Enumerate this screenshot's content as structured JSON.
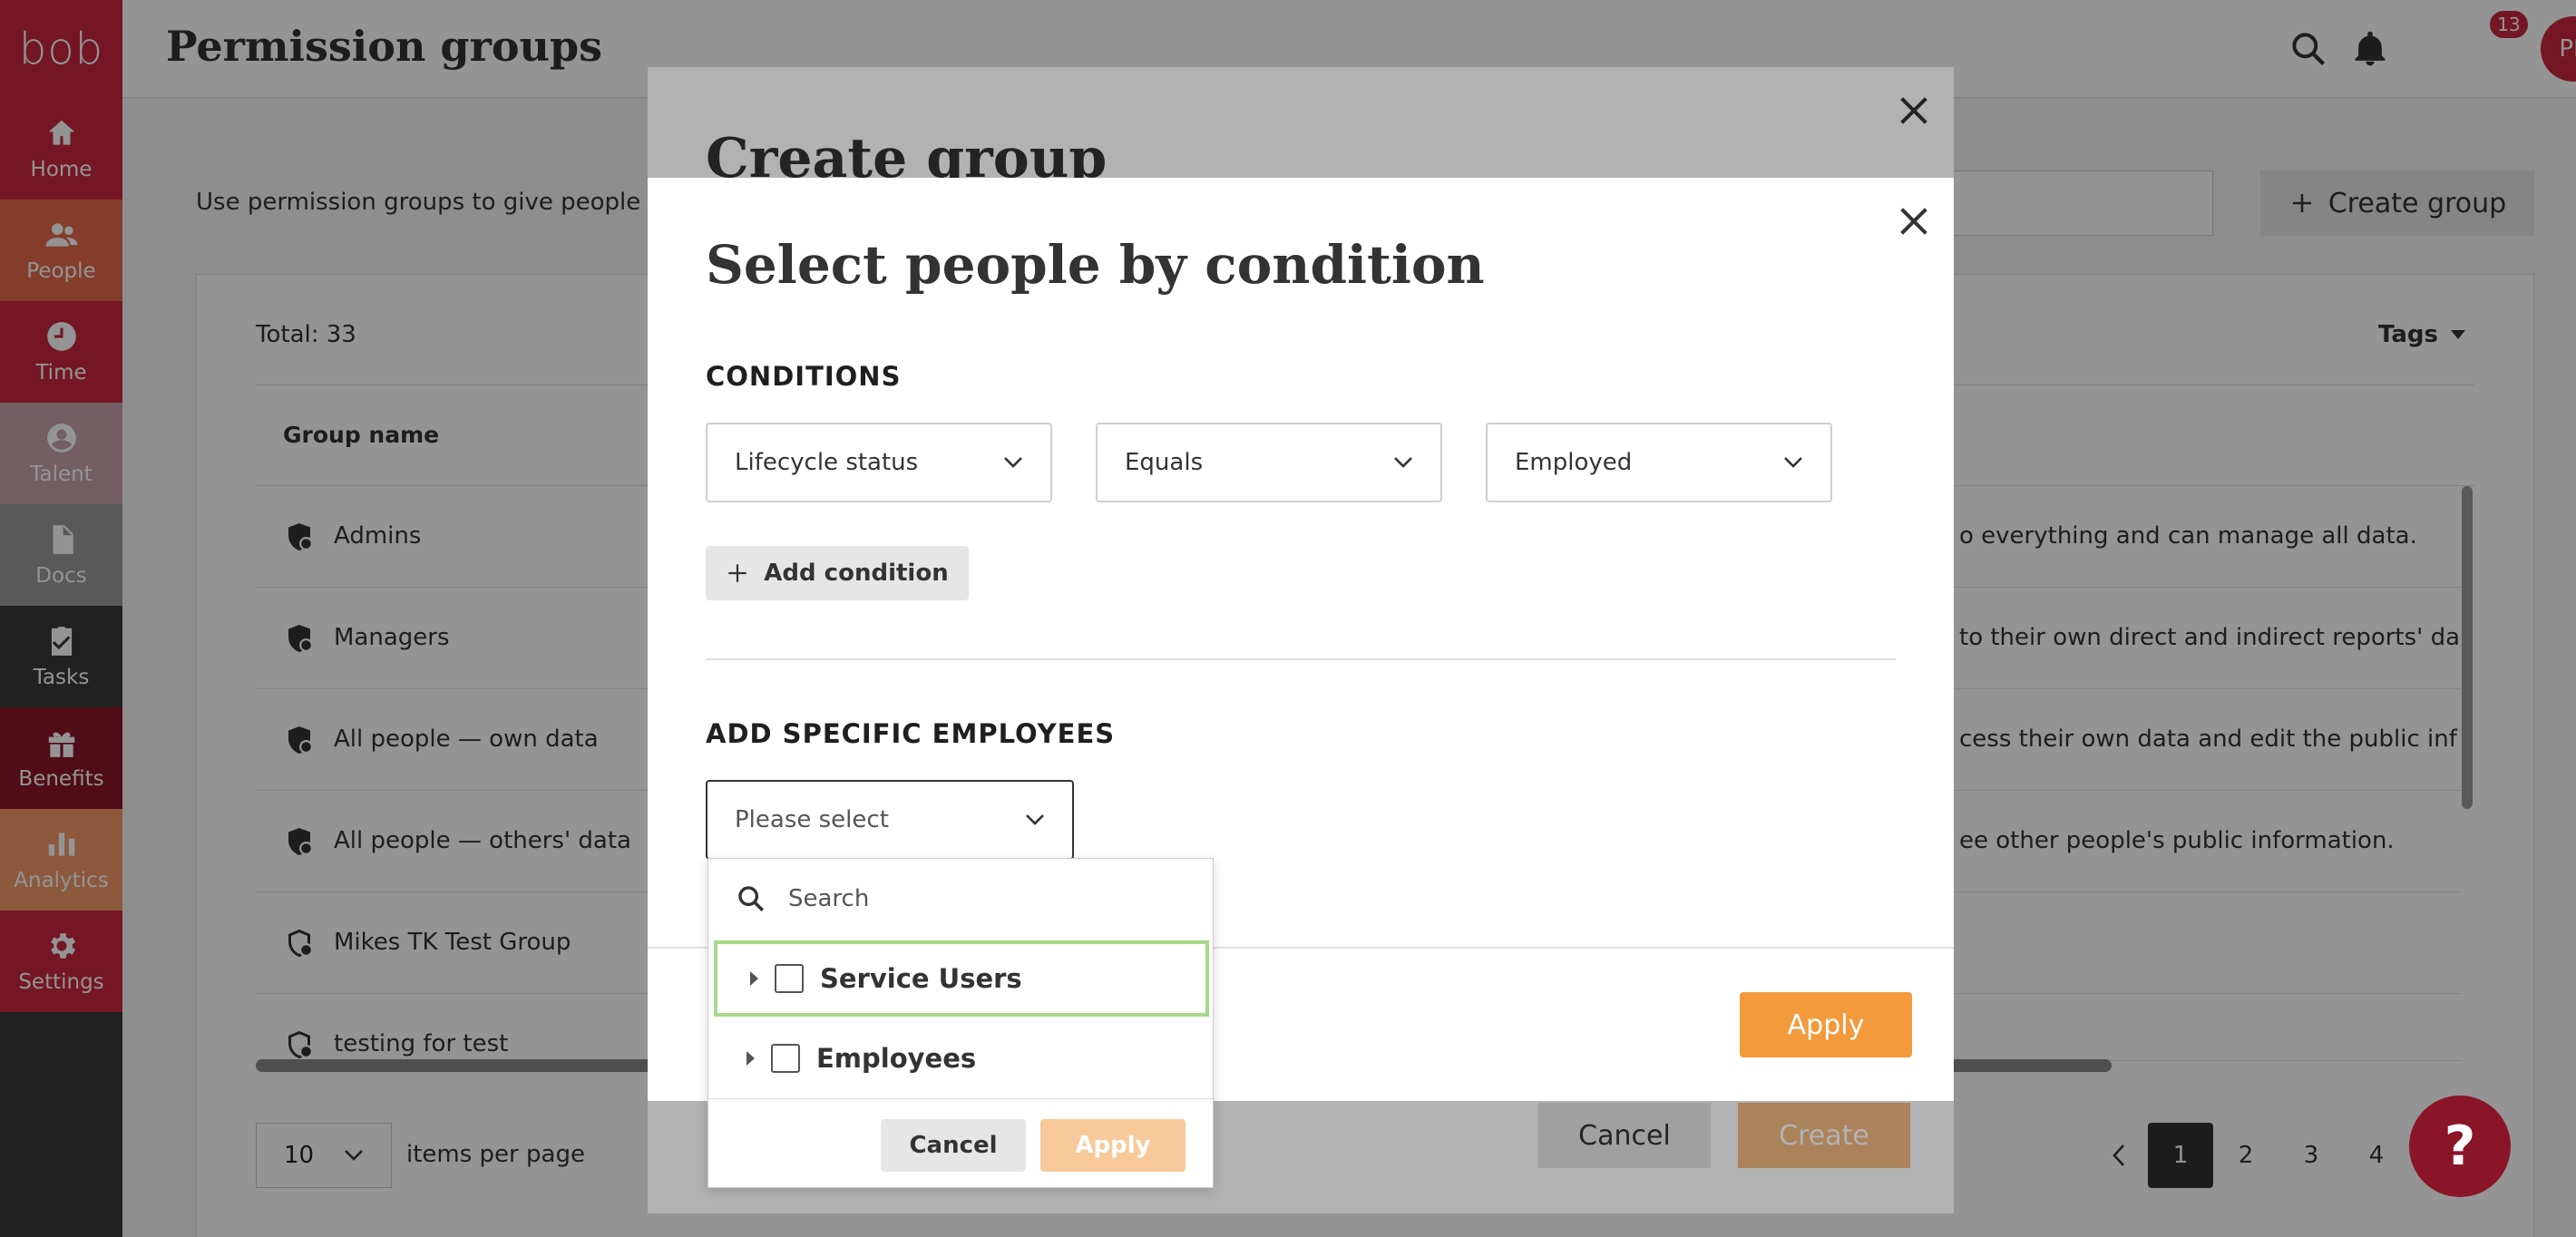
{
  "app": {
    "logo": "bob"
  },
  "sidebar": {
    "items": [
      {
        "label": "Home",
        "icon": "home-icon",
        "color": "#c8263f"
      },
      {
        "label": "People",
        "icon": "people-icon",
        "color": "#e46a4a"
      },
      {
        "label": "Time",
        "icon": "clock-icon",
        "color": "#c8263f"
      },
      {
        "label": "Talent",
        "icon": "talent-icon",
        "color": "#c7a3ad"
      },
      {
        "label": "Docs",
        "icon": "docs-icon",
        "color": "#9a9a9a"
      },
      {
        "label": "Tasks",
        "icon": "tasks-icon",
        "color": "#3a3a3a"
      },
      {
        "label": "Benefits",
        "icon": "gift-icon",
        "color": "#8a1528"
      },
      {
        "label": "Analytics",
        "icon": "analytics-icon",
        "color": "#f29a6a"
      },
      {
        "label": "Settings",
        "icon": "gear-icon",
        "color": "#c8263f"
      }
    ]
  },
  "header": {
    "title": "Permission groups",
    "notifications": "13",
    "avatar": "PP"
  },
  "main": {
    "description": "Use permission groups to give people th",
    "create_button": "Create group",
    "total": "Total: 33",
    "tags": "Tags",
    "column": "Group name",
    "rows": [
      {
        "name": "Admins",
        "desc": "o everything and can manage all data."
      },
      {
        "name": "Managers",
        "desc": "to their own direct and indirect reports' data"
      },
      {
        "name": "All people — own data",
        "desc": "cess their own data and edit the public inform"
      },
      {
        "name": "All people — others' data",
        "desc": "ee other people's public information."
      },
      {
        "name": "Mikes TK Test Group",
        "desc": ""
      },
      {
        "name": "testing for test",
        "desc": ""
      }
    ],
    "per_page_value": "10",
    "per_page_label": "items per page",
    "pages": [
      "1",
      "2",
      "3",
      "4"
    ]
  },
  "back_modal": {
    "title": "Create group",
    "cancel": "Cancel",
    "create": "Create"
  },
  "front_modal": {
    "title": "Select people by condition",
    "conditions_label": "CONDITIONS",
    "field": "Lifecycle status",
    "operator": "Equals",
    "value": "Employed",
    "add_condition": "Add condition",
    "specific_label": "ADD SPECIFIC EMPLOYEES",
    "select_placeholder": "Please select",
    "apply": "Apply"
  },
  "dropdown": {
    "search_placeholder": "Search",
    "items": [
      "Service Users",
      "Employees"
    ],
    "cancel": "Cancel",
    "apply": "Apply"
  }
}
